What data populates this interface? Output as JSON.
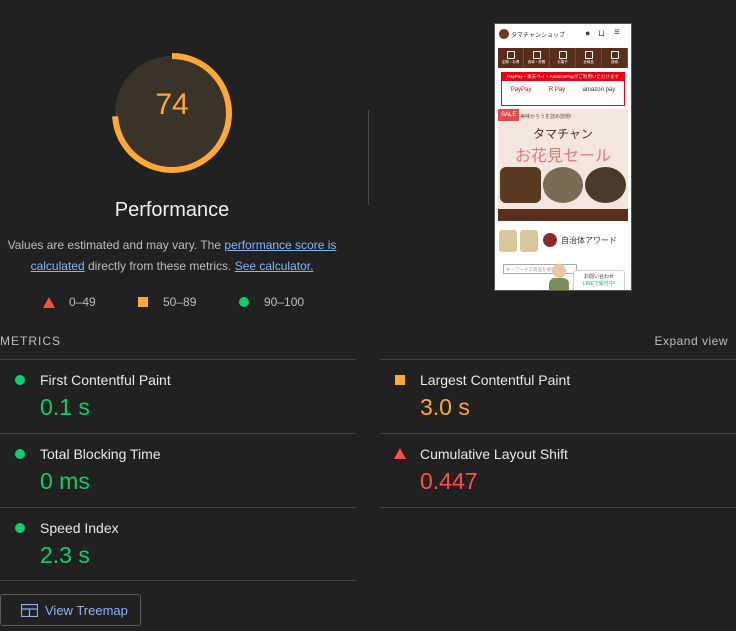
{
  "gauge": {
    "score": "74",
    "fraction": 0.74,
    "color": "#ffa836",
    "track_color": "#3a332a"
  },
  "performance_title": "Performance",
  "description": {
    "prefix": "Values are estimated and may vary. The ",
    "link1": "performance score is calculated",
    "middle": " directly from these metrics. ",
    "link2": "See calculator."
  },
  "legend": [
    {
      "range": "0–49",
      "shape": "triangle",
      "color": "#ff4e42"
    },
    {
      "range": "50–89",
      "shape": "square",
      "color": "#ffa836"
    },
    {
      "range": "90–100",
      "shape": "circle",
      "color": "#0cce6b"
    }
  ],
  "screenshot_thumbnail": {
    "shop_name": "タマチャンショップ",
    "nav_items": [
      "定期・お得",
      "食事・栄養",
      "お菓子",
      "全商品",
      "検索"
    ],
    "payment_banner": "PayPay・楽天ペイ・AmazonPayがご利用いただけます",
    "payment_logos": [
      "PayPay",
      "R Pay",
      "amazon pay"
    ],
    "sale_badge": "SALE",
    "sale_top_text": "美味かろうを詰め放題!",
    "sale_title_1": "タマチャン",
    "sale_title_2": "お花見セール",
    "award_text": "自治体アワード",
    "search_placeholder": "キーワードで商品を検索",
    "contact_line1": "お問い合わせ",
    "contact_line2": "LINEで受付中!"
  },
  "metrics_heading": "METRICS",
  "expand_view": "Expand view",
  "metrics": {
    "fcp": {
      "name": "First Contentful Paint",
      "value": "0.1 s"
    },
    "lcp": {
      "name": "Largest Contentful Paint",
      "value": "3.0 s"
    },
    "tbt": {
      "name": "Total Blocking Time",
      "value": "0 ms"
    },
    "cls": {
      "name": "Cumulative Layout Shift",
      "value": "0.447"
    },
    "si": {
      "name": "Speed Index",
      "value": "2.3 s"
    }
  },
  "treemap_button": "View Treemap"
}
